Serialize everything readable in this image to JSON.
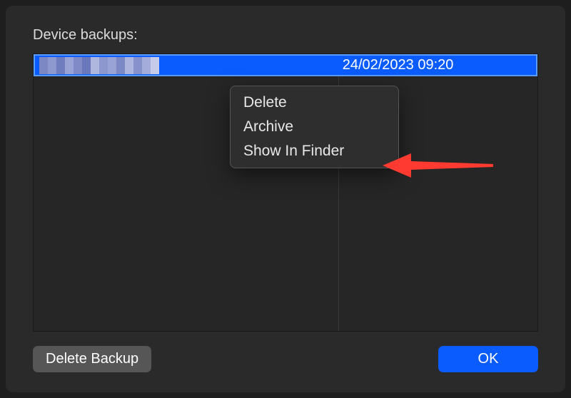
{
  "section_label": "Device backups:",
  "backup_row": {
    "date": "24/02/2023 09:20"
  },
  "context_menu": {
    "delete": "Delete",
    "archive": "Archive",
    "show_in_finder": "Show In Finder"
  },
  "buttons": {
    "delete_backup": "Delete Backup",
    "ok": "OK"
  },
  "colors": {
    "selection": "#0a5cff",
    "arrow": "#ff3a30"
  }
}
